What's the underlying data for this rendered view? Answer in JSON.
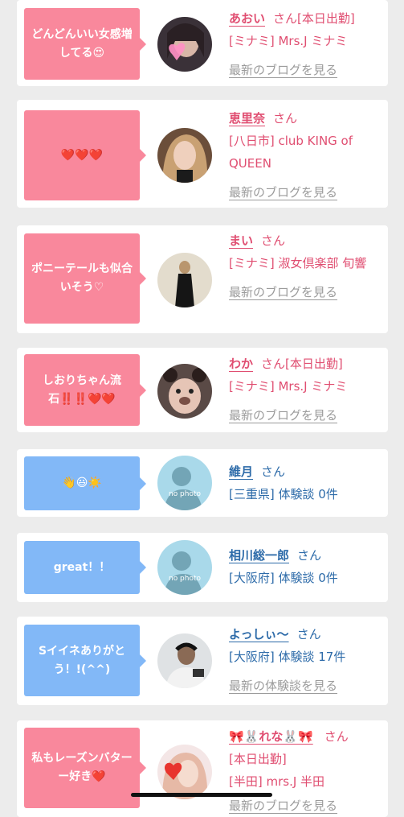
{
  "entries": [
    {
      "message": "どんどんいい女感増してる😍",
      "name": "あおい",
      "suffix": "さん[本日出勤]",
      "location": "[ミナミ] Mrs.J ミナミ",
      "link": "最新のブログを見る",
      "theme": "pink",
      "avatar_icon": "photo-icon"
    },
    {
      "message": "❤️❤️❤️",
      "name": "恵里奈",
      "suffix": "さん",
      "location": "[八日市] club KING of QUEEN",
      "link": "最新のブログを見る",
      "theme": "pink",
      "avatar_icon": "photo-icon"
    },
    {
      "message": "ポニーテールも似合いそう♡",
      "name": "まい",
      "suffix": "さん",
      "location": "[ミナミ] 淑女倶楽部 旬響",
      "link": "最新のブログを見る",
      "theme": "pink",
      "avatar_icon": "photo-icon"
    },
    {
      "message": "しおりちゃん流石‼️‼️❤️❤️",
      "name": "わか",
      "suffix": "さん[本日出勤]",
      "location": "[ミナミ] Mrs.J ミナミ",
      "link": "最新のブログを見る",
      "theme": "pink",
      "avatar_icon": "photo-icon"
    },
    {
      "message": "👋😃☀️",
      "name": "維月",
      "suffix": "さん",
      "location": "[三重県] 体験談 0件",
      "link": "",
      "theme": "blue",
      "avatar_icon": "no-photo-icon"
    },
    {
      "message": "great！！",
      "name": "相川総一郎",
      "suffix": "さん",
      "location": "[大阪府] 体験談 0件",
      "link": "",
      "theme": "blue",
      "avatar_icon": "no-photo-icon"
    },
    {
      "message": "Sイイネありがとう！!(^^)",
      "name": "よっしぃ〜",
      "suffix": "さん",
      "location": "[大阪府] 体験談 17件",
      "link": "最新の体験談を見る",
      "theme": "blue",
      "avatar_icon": "photo-icon"
    },
    {
      "message": "私もレーズンバターー好き❤️",
      "name": "🎀🐰れな🐰🎀",
      "suffix": "さん",
      "status": "[本日出勤]",
      "location": "[半田] mrs.J 半田",
      "link": "最新のブログを見る",
      "theme": "pink",
      "avatar_icon": "photo-icon"
    }
  ],
  "colors": {
    "pink_bubble": "#f9889c",
    "blue_bubble": "#82b8f7",
    "pink_text": "#e04e71",
    "blue_text": "#2d6ba9",
    "link_gray": "#9b9b9b",
    "background": "#ececec"
  },
  "no_photo_label": "no photo"
}
